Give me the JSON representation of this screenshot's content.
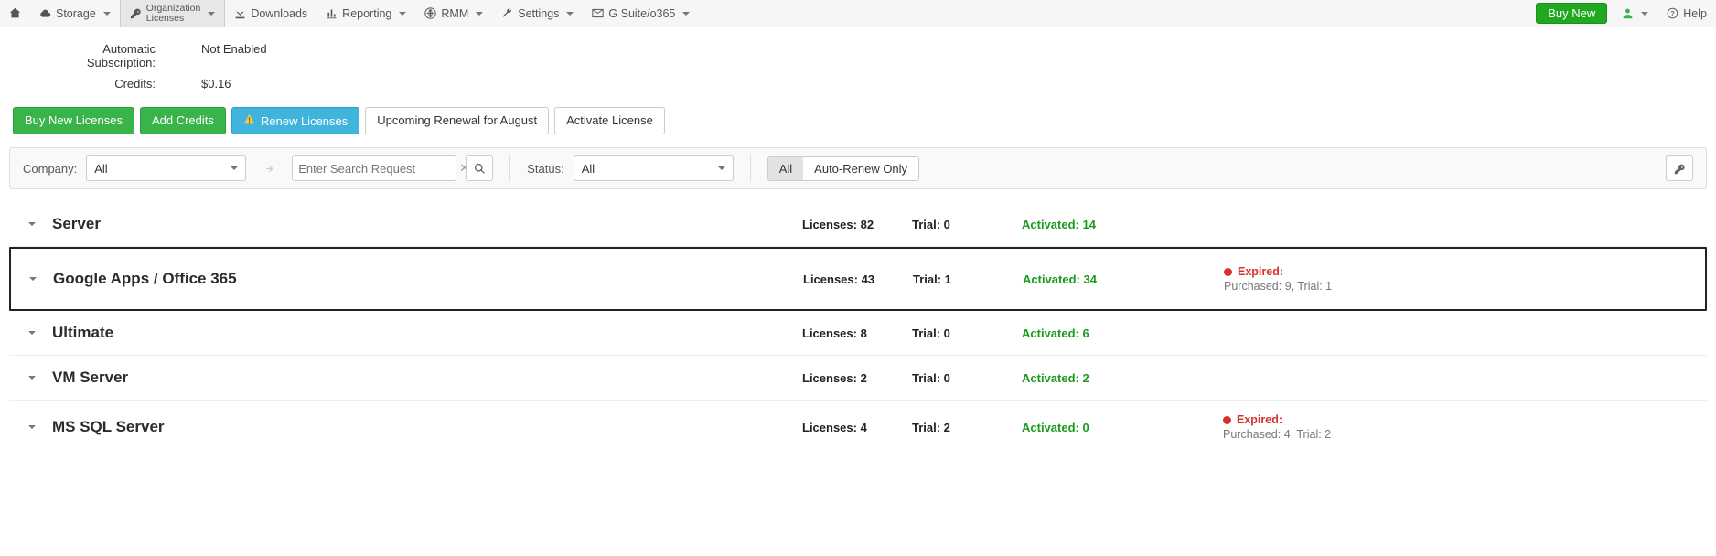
{
  "nav": {
    "storage": "Storage",
    "org_licenses_line1": "Organization",
    "org_licenses_line2": "Licenses",
    "downloads": "Downloads",
    "reporting": "Reporting",
    "rmm": "RMM",
    "settings": "Settings",
    "gsuite": "G Suite/o365",
    "buy_new": "Buy New",
    "help": "Help"
  },
  "info": {
    "sub_label": "Automatic Subscription:",
    "sub_value": "Not Enabled",
    "credits_label": "Credits:",
    "credits_value": "$0.16"
  },
  "actions": {
    "buy_licenses": "Buy New Licenses",
    "add_credits": "Add Credits",
    "renew": "Renew Licenses",
    "upcoming": "Upcoming Renewal for August",
    "activate": "Activate License"
  },
  "filter": {
    "company_label": "Company:",
    "company_value": "All",
    "search_placeholder": "Enter Search Request",
    "status_label": "Status:",
    "status_value": "All",
    "seg_all": "All",
    "seg_auto": "Auto-Renew Only"
  },
  "groups": [
    {
      "name": "Server",
      "licenses": "Licenses: 82",
      "trial": "Trial: 0",
      "activated": "Activated: 14",
      "highlighted": false,
      "expired": null
    },
    {
      "name": "Google Apps / Office 365",
      "licenses": "Licenses: 43",
      "trial": "Trial: 1",
      "activated": "Activated: 34",
      "highlighted": true,
      "expired": {
        "title": "Expired:",
        "detail": "Purchased: 9, Trial: 1"
      }
    },
    {
      "name": "Ultimate",
      "licenses": "Licenses: 8",
      "trial": "Trial: 0",
      "activated": "Activated: 6",
      "highlighted": false,
      "expired": null
    },
    {
      "name": "VM Server",
      "licenses": "Licenses: 2",
      "trial": "Trial: 0",
      "activated": "Activated: 2",
      "highlighted": false,
      "expired": null
    },
    {
      "name": "MS SQL Server",
      "licenses": "Licenses: 4",
      "trial": "Trial: 2",
      "activated": "Activated: 0",
      "highlighted": false,
      "expired": {
        "title": "Expired:",
        "detail": "Purchased: 4, Trial: 2"
      }
    }
  ]
}
